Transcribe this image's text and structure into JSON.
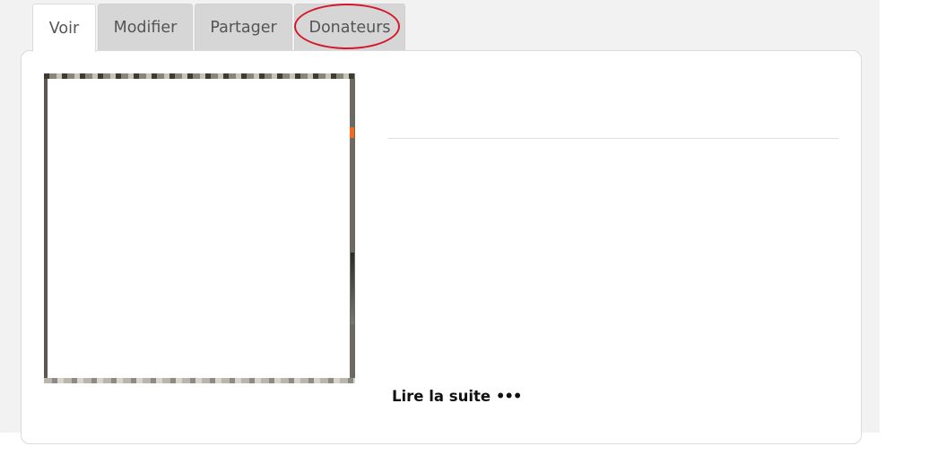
{
  "tabs": [
    {
      "label": "Voir",
      "active": true
    },
    {
      "label": "Modifier",
      "active": false
    },
    {
      "label": "Partager",
      "active": false
    },
    {
      "label": "Donateurs",
      "active": false
    }
  ],
  "annotation": {
    "target": "Donateurs",
    "color": "#d6172a"
  },
  "content": {
    "read_more_label": "Lire la suite",
    "read_more_icon": "•••"
  },
  "colors": {
    "page_background": "#f2f2f2",
    "tab_inactive": "#d6d6d6",
    "panel": "#ffffff"
  }
}
